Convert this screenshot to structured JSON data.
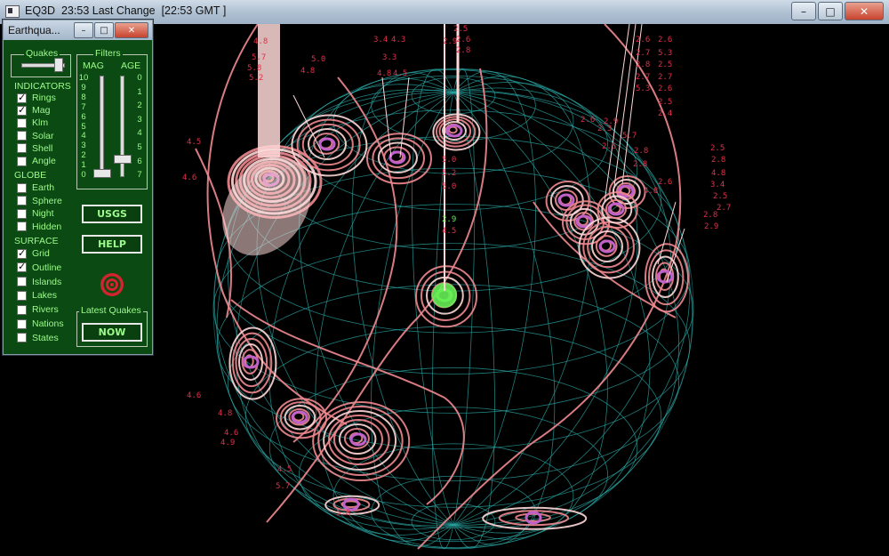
{
  "window": {
    "title": "EQ3D  23:53 Last Change  [22:53 GMT ]",
    "buttons": {
      "minimize": "–",
      "maximize": "□",
      "close": "✕"
    }
  },
  "panel": {
    "title": "Earthqua...",
    "buttons": {
      "minimize": "–",
      "maximize": "□",
      "close": "✕"
    },
    "quakes_group": "Quakes",
    "filters_group": "Filters",
    "mag_label": "MAG",
    "age_label": "AGE",
    "mag_scale": [
      "10",
      "9",
      "8",
      "7",
      "6",
      "5",
      "4",
      "3",
      "2",
      "1",
      "0"
    ],
    "age_scale": [
      "0",
      "1",
      "2",
      "3",
      "4",
      "5",
      "6",
      "7"
    ],
    "sections": {
      "indicators": "INDICATORS",
      "globe": "GLOBE",
      "surface": "SURFACE"
    },
    "indicators": [
      {
        "label": "Rings",
        "checked": true
      },
      {
        "label": "Mag",
        "checked": true
      },
      {
        "label": "Klm",
        "checked": false
      },
      {
        "label": "Solar",
        "checked": false
      },
      {
        "label": "Shell",
        "checked": false
      },
      {
        "label": "Angle",
        "checked": false
      }
    ],
    "globe": [
      {
        "label": "Earth",
        "checked": false
      },
      {
        "label": "Sphere",
        "checked": false
      },
      {
        "label": "Night",
        "checked": false
      },
      {
        "label": "Hidden",
        "checked": false
      }
    ],
    "surface": [
      {
        "label": "Grid",
        "checked": true
      },
      {
        "label": "Outline",
        "checked": true
      },
      {
        "label": "Islands",
        "checked": false
      },
      {
        "label": "Lakes",
        "checked": false
      },
      {
        "label": "Rivers",
        "checked": false
      },
      {
        "label": "Nations",
        "checked": false
      },
      {
        "label": "States",
        "checked": false
      }
    ],
    "usgs_button": "USGS",
    "help_button": "HELP",
    "latest_group": "Latest Quakes",
    "now_button": "NOW"
  },
  "quake_labels": [
    "4.8",
    "5.7",
    "5.8",
    "5.2",
    "4.8",
    "5.0",
    "3.4",
    "4.3",
    "3.3",
    "4.8",
    "4.5",
    "2.5",
    "2.6",
    "2.8",
    "2.9",
    "2.6",
    "2.7",
    "2.8",
    "2.7",
    "5.3",
    "2.6",
    "5.3",
    "2.5",
    "2.7",
    "2.6",
    "2.5",
    "2.4",
    "2.6",
    "2.3",
    "5.7",
    "2.9",
    "2.5",
    "2.8",
    "2.8",
    "2.6",
    "2.5",
    "2.8",
    "4.8",
    "3.4",
    "2.5",
    "2.7",
    "2.8",
    "2.9",
    "4.8",
    "4.5",
    "4.6",
    "2.9",
    "4.5",
    "5.0",
    "5.0",
    "5.2",
    "4.6",
    "4.8",
    "4.6",
    "4.9",
    "4.5",
    "5.7",
    "5.8"
  ],
  "colors": {
    "ring": "#f08a90",
    "ring_light": "#ffd8d8",
    "core": "#c060c8",
    "grid": "#2aa7a4",
    "label": "#e0304a",
    "latest": "#66ee55",
    "panel_bg": "#0b4a12",
    "panel_text": "#9dfc8c"
  }
}
